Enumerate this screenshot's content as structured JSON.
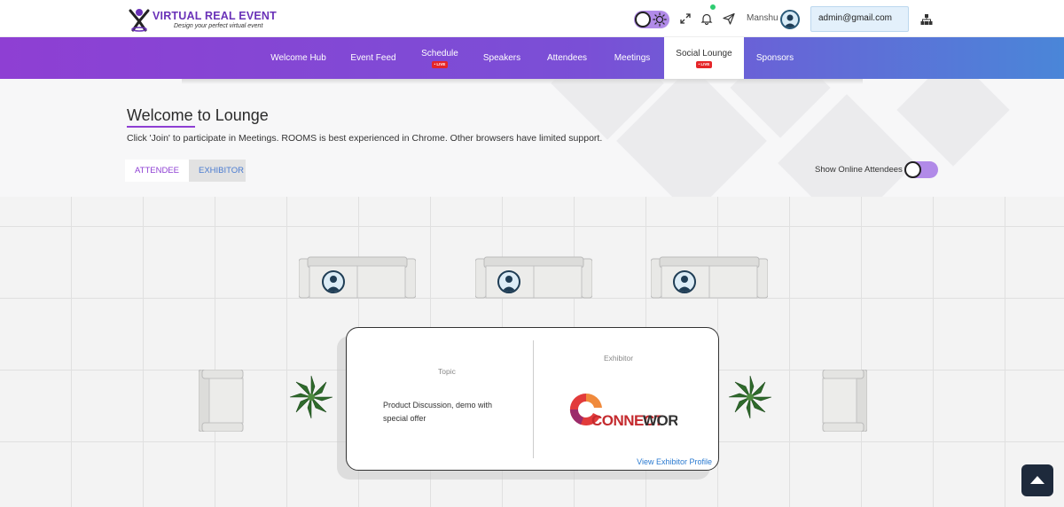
{
  "header": {
    "logo_title": "VIRTUAL REAL EVENT",
    "logo_tagline": "Design your perfect virtual event",
    "user_name": "Manshu",
    "email": "admin@gmail.com"
  },
  "nav": {
    "items": [
      {
        "label": "Welcome Hub",
        "live": false
      },
      {
        "label": "Event Feed",
        "live": false
      },
      {
        "label": "Schedule",
        "live": true
      },
      {
        "label": "Speakers",
        "live": false
      },
      {
        "label": "Attendees",
        "live": false
      },
      {
        "label": "Meetings",
        "live": false
      },
      {
        "label": "Social Lounge",
        "live": true,
        "active": true
      },
      {
        "label": "Sponsors",
        "live": false
      }
    ],
    "live_label": "• LIVE"
  },
  "page": {
    "title": "Welcome to Lounge",
    "subtitle": "Click 'Join' to participate in Meetings. ROOMS is best experienced in Chrome. Other browsers have limited support.",
    "tabs": [
      "ATTENDEE",
      "EXHIBITOR"
    ],
    "online_label": "Show Online Attendees"
  },
  "room": {
    "topic_label": "Topic",
    "topic_text": "Product Discussion, demo with special offer",
    "exhibitor_label": "Exhibitor",
    "exhibitor_logo_a": "CONNECT",
    "exhibitor_logo_b": "WORKS",
    "view_link": "View Exhibitor Profile"
  },
  "colors": {
    "brand_purple": "#8e3fd3",
    "nav_blue": "#4a86d8",
    "live_red": "#e52528",
    "link_blue": "#2a7ad0"
  }
}
